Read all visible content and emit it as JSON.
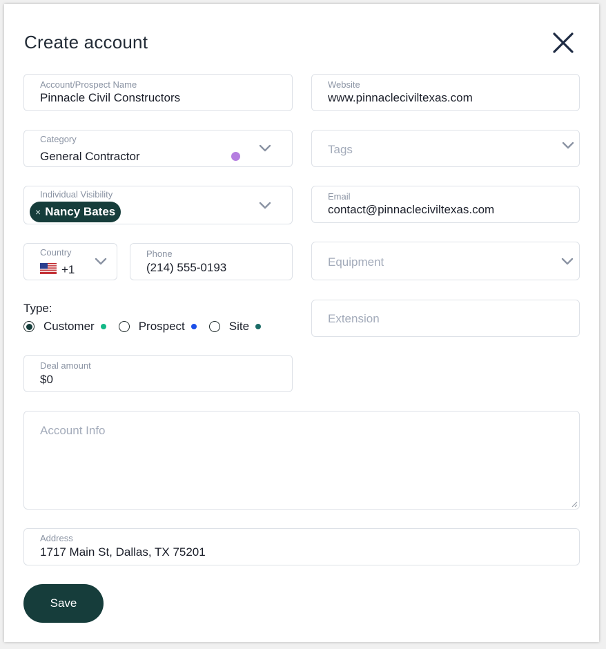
{
  "dialog": {
    "title": "Create account"
  },
  "fields": {
    "account_name": {
      "label": "Account/Prospect Name",
      "value": "Pinnacle Civil Constructors"
    },
    "website": {
      "label": "Website",
      "value": "www.pinnaclecivilte​xas.com"
    },
    "category": {
      "label": "Category",
      "value": "General Contractor",
      "indicator_color": "#b57ee0"
    },
    "tags": {
      "placeholder": "Tags"
    },
    "visibility": {
      "label": "Individual Visibility",
      "chip": "Nancy Bates",
      "chip_remove": "×"
    },
    "email": {
      "label": "Email",
      "value": "contact@pinnacleciviltexas.com"
    },
    "country": {
      "label": "Country",
      "code": "+1"
    },
    "phone": {
      "label": "Phone",
      "value": "(214) 555-0193"
    },
    "equipment": {
      "placeholder": "Equipment"
    },
    "extension": {
      "placeholder": "Extension"
    },
    "deal_amount": {
      "label": "Deal amount",
      "value": "$0"
    },
    "account_info": {
      "placeholder": "Account Info"
    },
    "address": {
      "label": "Address",
      "value": "1717 Main St, Dallas, TX 75201"
    }
  },
  "type": {
    "label": "Type:",
    "options": [
      {
        "label": "Customer",
        "checked": true,
        "color": "#12b886"
      },
      {
        "label": "Prospect",
        "checked": false,
        "color": "#1c4fe8"
      },
      {
        "label": "Site",
        "checked": false,
        "color": "#1a6b66"
      }
    ]
  },
  "actions": {
    "save_label": "Save"
  },
  "colors": {
    "primary": "#163d3b",
    "border": "#dde1e7",
    "label": "#8a93a3"
  }
}
